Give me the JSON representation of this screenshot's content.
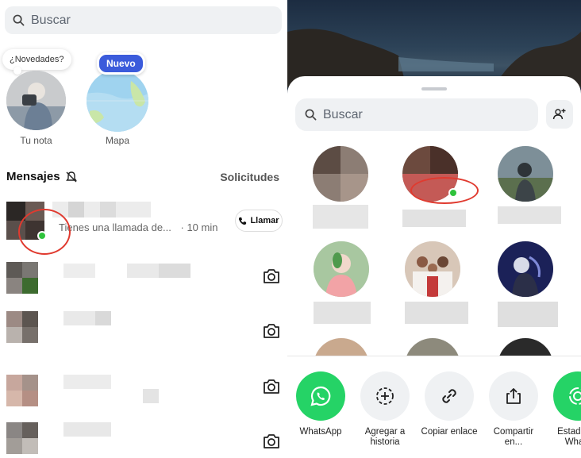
{
  "left": {
    "search_placeholder": "Buscar",
    "note_bubble": "¿Novedades?",
    "stories": [
      {
        "label": "Tu nota"
      },
      {
        "label": "Mapa",
        "badge": "Nuevo"
      }
    ],
    "section_title": "Mensajes",
    "requests_label": "Solicitudes",
    "first_conversation": {
      "preview": "Tienes una llamada de...",
      "time": "· 10 min",
      "call_label": "Llamar"
    }
  },
  "right": {
    "search_placeholder": "Buscar",
    "share_actions": [
      {
        "label": "WhatsApp",
        "icon": "whatsapp-icon"
      },
      {
        "label": "Agregar a historia",
        "icon": "add-story-icon"
      },
      {
        "label": "Copiar enlace",
        "icon": "link-icon"
      },
      {
        "label": "Compartir en...",
        "icon": "share-icon"
      },
      {
        "label": "Estado de Whats",
        "icon": "status-icon"
      }
    ]
  },
  "colors": {
    "whatsapp_green": "#25d366",
    "nuevo_blue": "#3b5bdb",
    "annotation_red": "#e03a2f",
    "online_green": "#2fc33c"
  }
}
